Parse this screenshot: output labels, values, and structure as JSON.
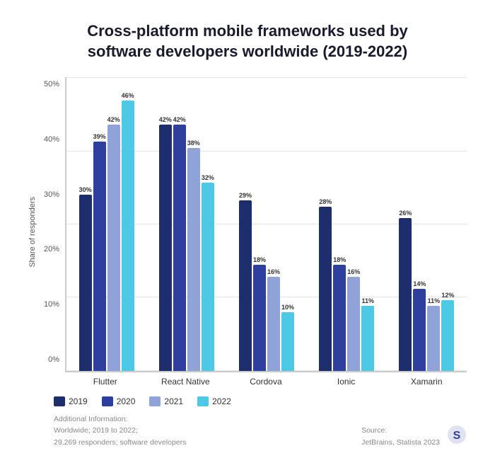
{
  "title": "Cross-platform mobile frameworks used by\nsoftware developers worldwide (2019-2022)",
  "yAxisTitle": "Share of responders",
  "yLabels": [
    "50%",
    "40%",
    "30%",
    "20%",
    "10%",
    "0%"
  ],
  "groups": [
    {
      "name": "Flutter",
      "bars": [
        {
          "year": "2019",
          "value": 30,
          "color": "#1e2d6b",
          "label": "30%"
        },
        {
          "year": "2020",
          "value": 39,
          "color": "#2e3f9e",
          "label": "39%"
        },
        {
          "year": "2021",
          "value": 42,
          "color": "#8fa3d8",
          "label": "42%"
        },
        {
          "year": "2022",
          "value": 46,
          "color": "#4dc9e6",
          "label": "46%"
        }
      ]
    },
    {
      "name": "React Native",
      "bars": [
        {
          "year": "2019",
          "value": 42,
          "color": "#1e2d6b",
          "label": "42%"
        },
        {
          "year": "2020",
          "value": 42,
          "color": "#2e3f9e",
          "label": "42%"
        },
        {
          "year": "2021",
          "value": 38,
          "color": "#8fa3d8",
          "label": "38%"
        },
        {
          "year": "2022",
          "value": 32,
          "color": "#4dc9e6",
          "label": "32%"
        }
      ]
    },
    {
      "name": "Cordova",
      "bars": [
        {
          "year": "2019",
          "value": 29,
          "color": "#1e2d6b",
          "label": "29%"
        },
        {
          "year": "2020",
          "value": 18,
          "color": "#2e3f9e",
          "label": "18%"
        },
        {
          "year": "2021",
          "value": 16,
          "color": "#8fa3d8",
          "label": "16%"
        },
        {
          "year": "2022",
          "value": 10,
          "color": "#4dc9e6",
          "label": "10%"
        }
      ]
    },
    {
      "name": "Ionic",
      "bars": [
        {
          "year": "2019",
          "value": 28,
          "color": "#1e2d6b",
          "label": "28%"
        },
        {
          "year": "2020",
          "value": 18,
          "color": "#2e3f9e",
          "label": "18%"
        },
        {
          "year": "2021",
          "value": 16,
          "color": "#8fa3d8",
          "label": "16%"
        },
        {
          "year": "2022",
          "value": 11,
          "color": "#4dc9e6",
          "label": "11%"
        }
      ]
    },
    {
      "name": "Xamarin",
      "bars": [
        {
          "year": "2019",
          "value": 26,
          "color": "#1e2d6b",
          "label": "26%"
        },
        {
          "year": "2020",
          "value": 14,
          "color": "#2e3f9e",
          "label": "14%"
        },
        {
          "year": "2021",
          "value": 11,
          "color": "#8fa3d8",
          "label": "11%"
        },
        {
          "year": "2022",
          "value": 12,
          "color": "#4dc9e6",
          "label": "12%"
        }
      ]
    }
  ],
  "legend": [
    {
      "year": "2019",
      "color": "#1e2d6b"
    },
    {
      "year": "2020",
      "color": "#2e3f9e"
    },
    {
      "year": "2021",
      "color": "#8fa3d8"
    },
    {
      "year": "2022",
      "color": "#4dc9e6"
    }
  ],
  "footer": {
    "left": "Additional Information:\nWorldwide; 2019 to 2022;\n29,269 responders; software developers",
    "right": "Source:\nJetBrains, Statista 2023"
  },
  "maxValue": 50
}
